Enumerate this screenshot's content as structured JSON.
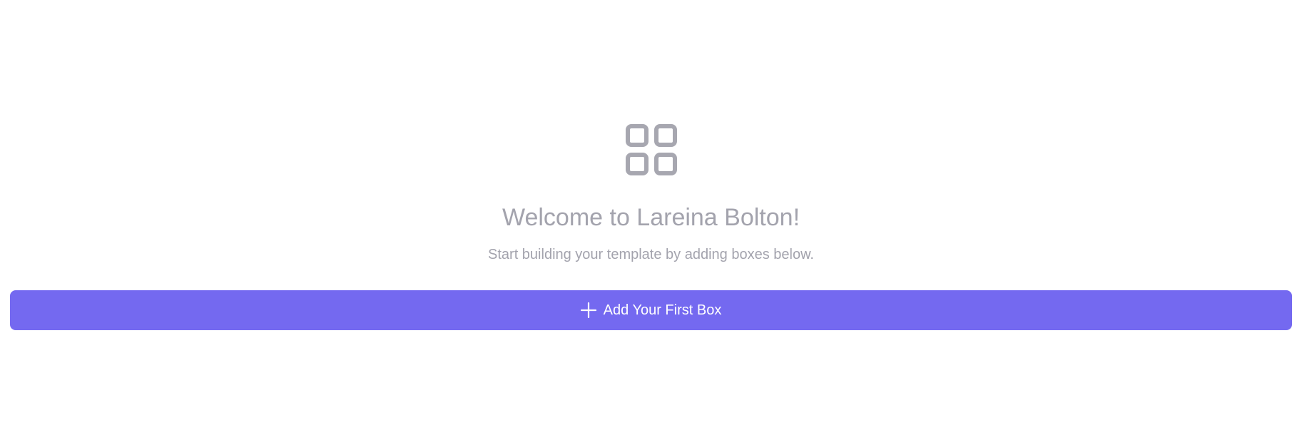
{
  "empty_state": {
    "icon": "grid-icon",
    "title": "Welcome to Lareina Bolton!",
    "subtitle": "Start building your template by adding boxes below.",
    "add_button": {
      "label": "Add Your First Box",
      "icon": "plus-icon"
    }
  },
  "colors": {
    "accent": "#7469f0",
    "muted_text": "#a3a3ad",
    "icon": "#a7a7b0",
    "background": "#ffffff"
  }
}
